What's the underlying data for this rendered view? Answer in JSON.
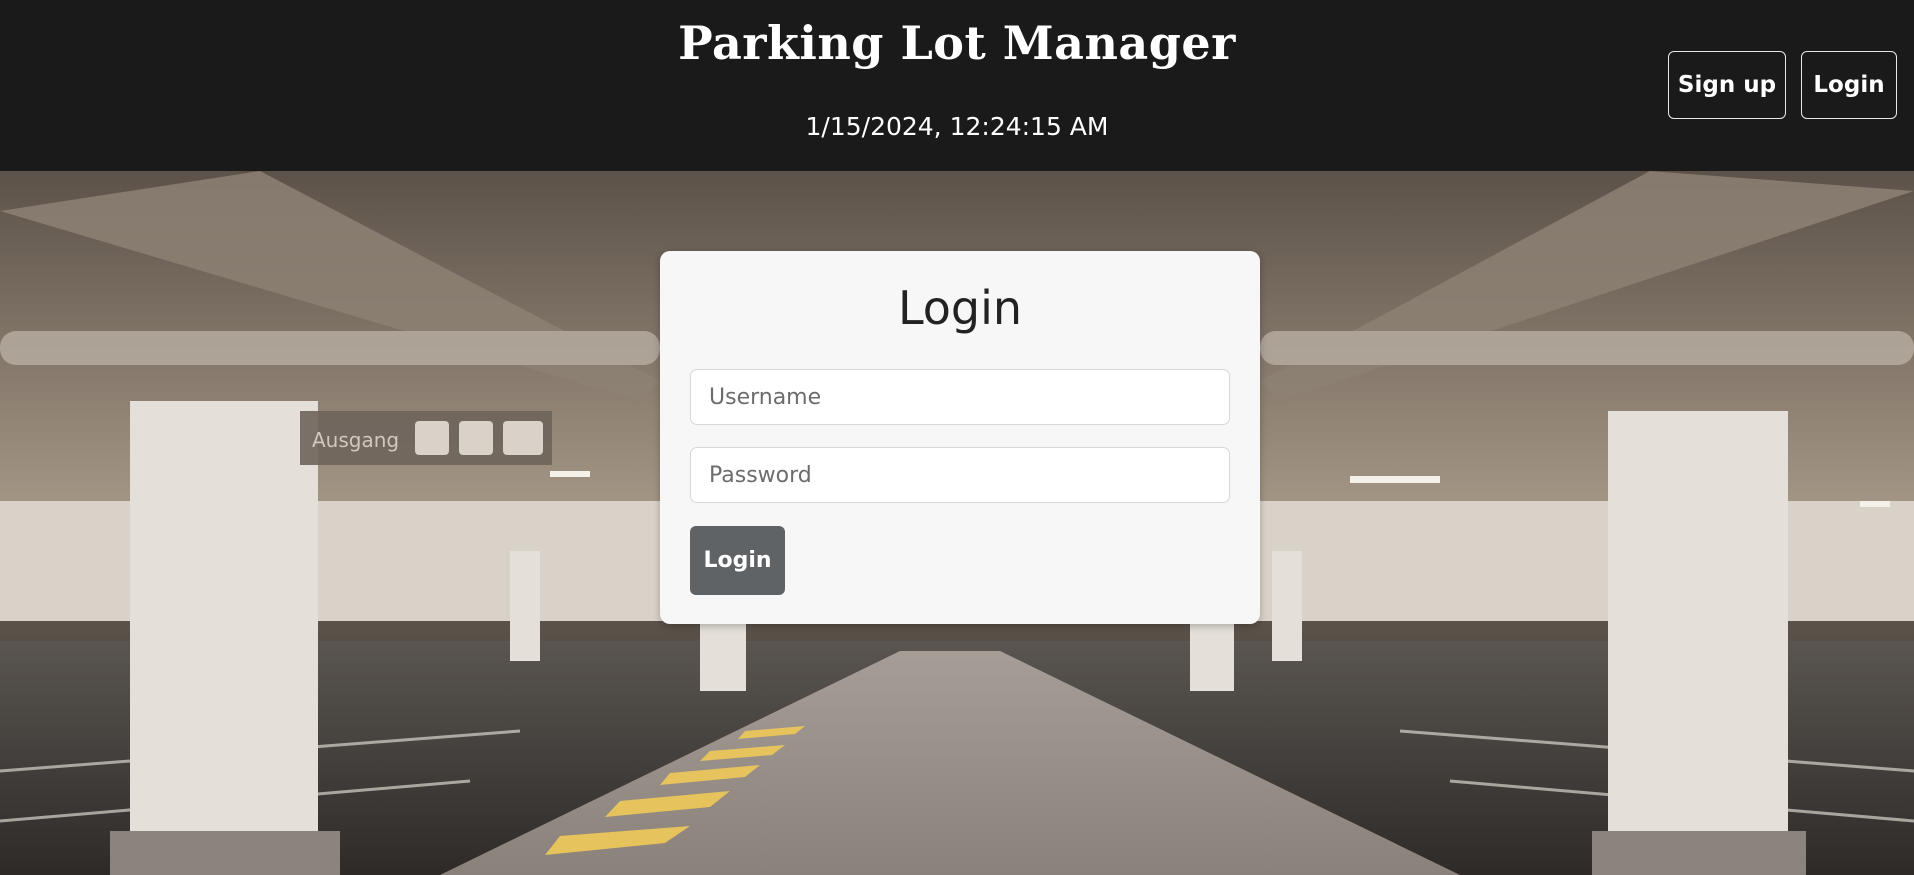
{
  "header": {
    "title": "Parking Lot Manager",
    "datetime": "1/15/2024, 12:24:15 AM",
    "signup_label": "Sign up",
    "login_label": "Login"
  },
  "background": {
    "sign_text": "Ausgang"
  },
  "login_form": {
    "title": "Login",
    "username_placeholder": "Username",
    "password_placeholder": "Password",
    "submit_label": "Login"
  }
}
